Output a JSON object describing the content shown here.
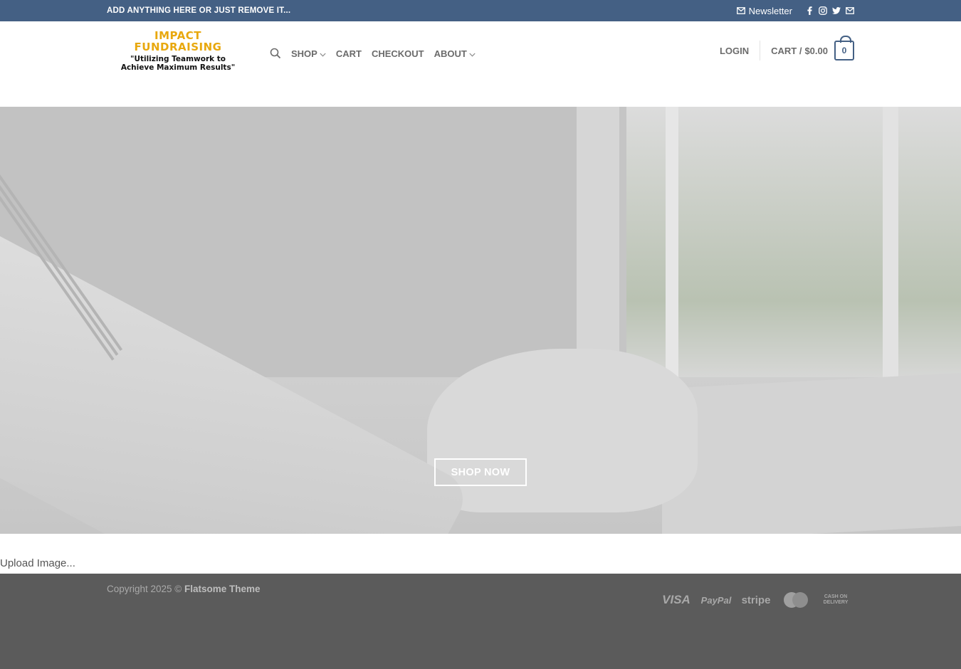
{
  "topbar": {
    "message": "ADD ANYTHING HERE OR JUST REMOVE IT...",
    "newsletter_label": "Newsletter",
    "social_icons": [
      "facebook-icon",
      "instagram-icon",
      "twitter-icon",
      "email-icon"
    ]
  },
  "logo": {
    "line1": "IMPACT",
    "line2": "FUNDRAISING",
    "line3": "\"Utilizing Teamwork to",
    "line4": "Achieve Maximum Results\""
  },
  "nav": {
    "items": [
      {
        "label": "SHOP",
        "has_dropdown": true
      },
      {
        "label": "CART",
        "has_dropdown": false
      },
      {
        "label": "CHECKOUT",
        "has_dropdown": false
      },
      {
        "label": "ABOUT",
        "has_dropdown": true
      }
    ]
  },
  "header_right": {
    "login": "LOGIN",
    "cart_label": "CART /",
    "cart_total": "$0.00",
    "cart_count": "0"
  },
  "hero": {
    "button_label": "SHOP NOW"
  },
  "main": {
    "upload_text": "Upload Image..."
  },
  "footer": {
    "copyright_prefix": "Copyright 2025 ©",
    "copyright_brand": "Flatsome Theme",
    "payments": [
      "VISA",
      "PayPal",
      "stripe",
      "MasterCard",
      "CASH ON DELIVERY"
    ]
  },
  "colors": {
    "primary": "#446084",
    "footer_bg": "#5b5b5b",
    "logo_gold": "#e8a80e"
  }
}
